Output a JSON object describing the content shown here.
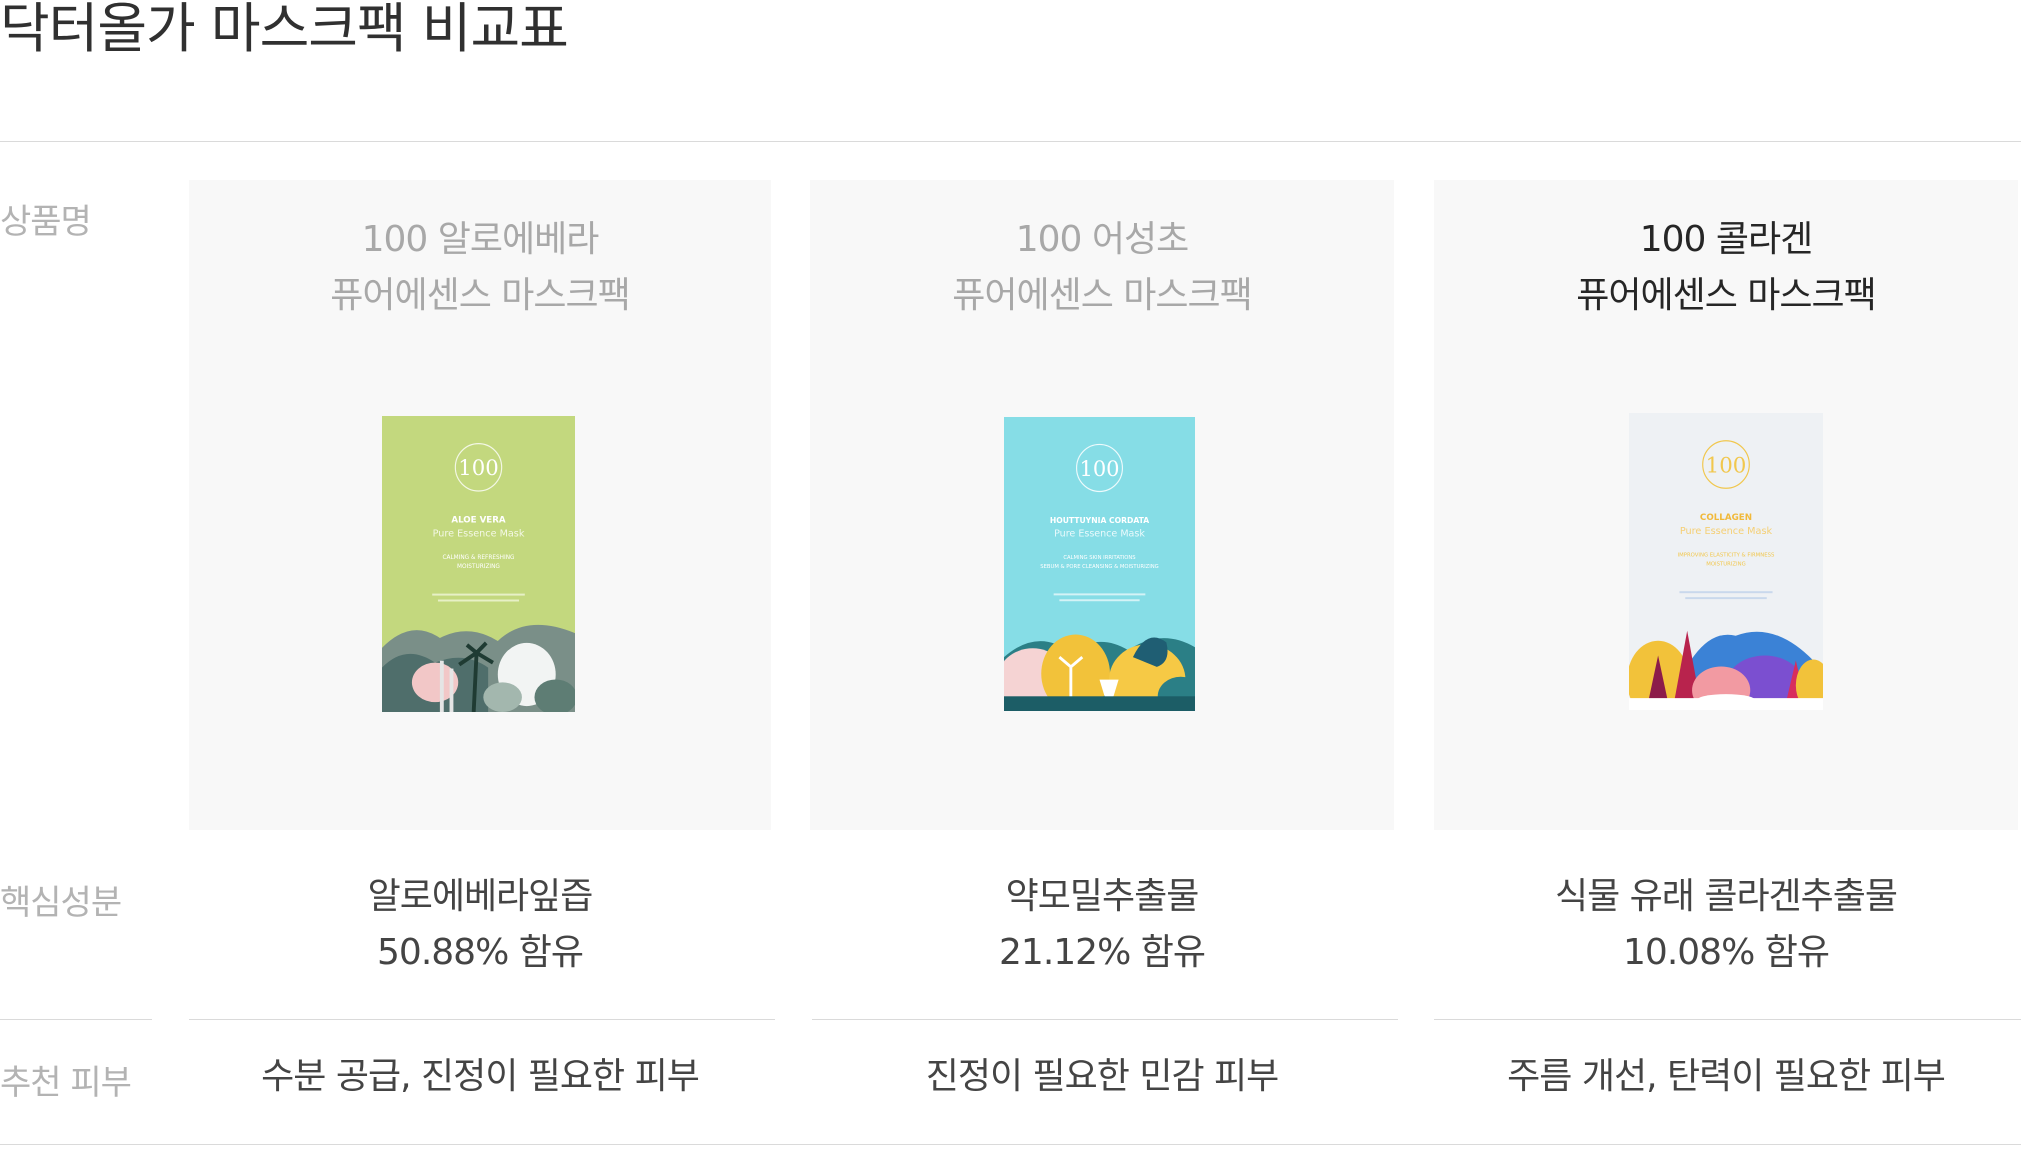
{
  "page_title": "닥터올가 마스크팩 비교표",
  "row_labels": {
    "product_name": "상품명",
    "key_ingredient": "핵심성분",
    "recommended_skin": "추천 피부"
  },
  "products": [
    {
      "name_line1": "100 알로에베라",
      "name_line2": "퓨어에센스 마스크팩",
      "selected": false,
      "pack": {
        "color": "#c3d87e",
        "brand_number": "100",
        "title": "ALOE VERA",
        "subtitle": "Pure Essence Mask",
        "claims_line1": "CALMING & REFRESHING",
        "claims_line2": "MOISTURIZING"
      },
      "ingredient_line1": "알로에베라잎즙",
      "ingredient_line2": "50.88% 함유",
      "recommended_skin": "수분 공급, 진정이 필요한 피부"
    },
    {
      "name_line1": "100 어성초",
      "name_line2": "퓨어에센스 마스크팩",
      "selected": false,
      "pack": {
        "color": "#86dde6",
        "brand_number": "100",
        "title": "HOUTTUYNIA CORDATA",
        "subtitle": "Pure Essence Mask",
        "claims_line1": "CALMING SKIN IRRITATIONS",
        "claims_line2": "SEBUM & PORE CLEANSING & MOISTURIZING"
      },
      "ingredient_line1": "약모밀추출물",
      "ingredient_line2": "21.12% 함유",
      "recommended_skin": "진정이 필요한 민감 피부"
    },
    {
      "name_line1": "100 콜라겐",
      "name_line2": "퓨어에센스 마스크팩",
      "selected": true,
      "pack": {
        "color": "#eef1f4",
        "brand_number": "100",
        "title": "COLLAGEN",
        "subtitle": "Pure Essence Mask",
        "claims_line1": "IMPROVING ELASTICITY & FIRMNESS",
        "claims_line2": "MOISTURIZING"
      },
      "ingredient_line1": "식물 유래 콜라겐추출물",
      "ingredient_line2": "10.08% 함유",
      "recommended_skin": "주름 개선, 탄력이 필요한 피부"
    }
  ]
}
